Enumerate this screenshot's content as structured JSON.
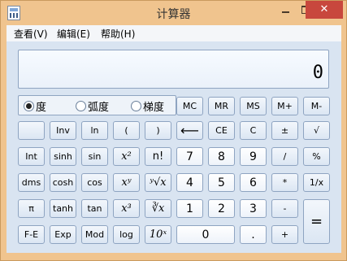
{
  "window": {
    "title": "计算器",
    "close_glyph": "✕"
  },
  "menu": [
    "查看(V)",
    "编辑(E)",
    "帮助(H)"
  ],
  "display": {
    "value": "0"
  },
  "angle_modes": [
    {
      "label": "度",
      "selected": true
    },
    {
      "label": "弧度",
      "selected": false
    },
    {
      "label": "梯度",
      "selected": false
    }
  ],
  "buttons": {
    "mc": "MC",
    "mr": "MR",
    "ms": "MS",
    "mplus": "M+",
    "mminus": "M-",
    "blank": "",
    "inv": "Inv",
    "ln": "ln",
    "lparen": "(",
    "rparen": ")",
    "back": "⟵",
    "ce": "CE",
    "c": "C",
    "plusminus": "±",
    "sqrt": "√",
    "int": "Int",
    "sinh": "sinh",
    "sin": "sin",
    "x2": "x²",
    "nfact": "n!",
    "d7": "7",
    "d8": "8",
    "d9": "9",
    "div": "/",
    "pct": "%",
    "dms": "dms",
    "cosh": "cosh",
    "cos": "cos",
    "xy": "xʸ",
    "yroot": "ʸ√x",
    "d4": "4",
    "d5": "5",
    "d6": "6",
    "mul": "*",
    "recip": "1/x",
    "pi": "π",
    "tanh": "tanh",
    "tan": "tan",
    "x3": "x³",
    "cbrt": "∛x",
    "d1": "1",
    "d2": "2",
    "d3": "3",
    "sub": "-",
    "eq": "=",
    "fe": "F-E",
    "exp": "Exp",
    "mod": "Mod",
    "log": "log",
    "pow10": "10ˣ",
    "d0": "0",
    "dot": ".",
    "add": "+"
  }
}
